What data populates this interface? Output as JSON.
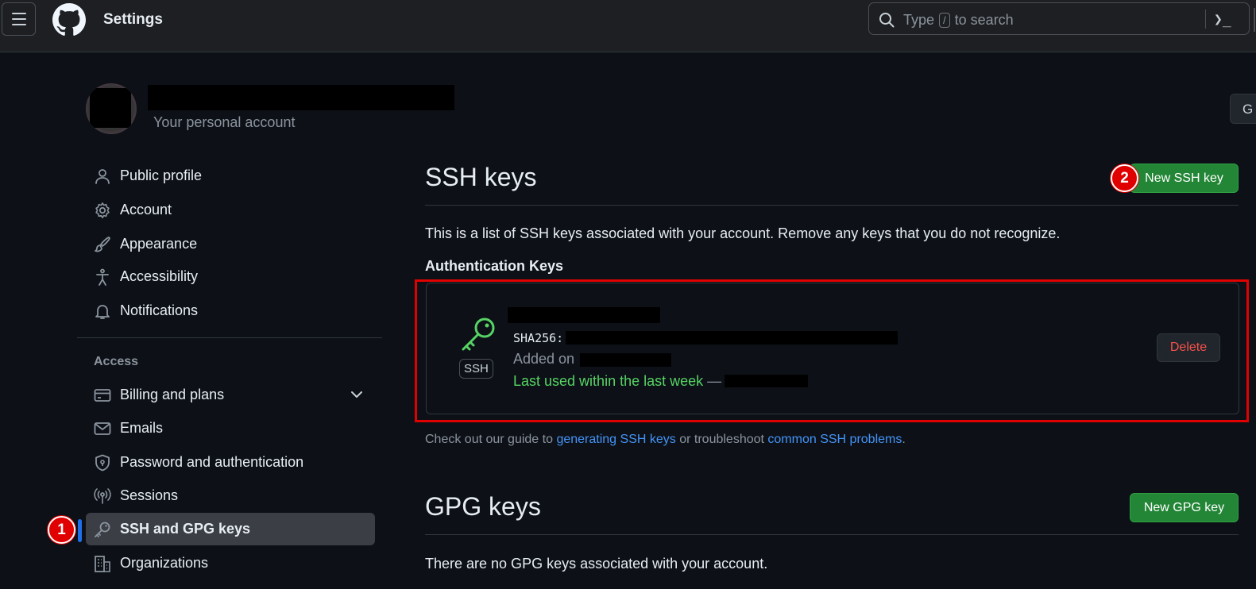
{
  "header": {
    "title": "Settings",
    "search_prefix": "Type",
    "search_kbd": "/",
    "search_suffix": "to search",
    "command_glyph": "❯_"
  },
  "profile": {
    "subtitle": "Your personal account",
    "go_button_partial": "G"
  },
  "sidebar": {
    "items": [
      {
        "label": "Public profile",
        "icon": "person-icon"
      },
      {
        "label": "Account",
        "icon": "gear-icon"
      },
      {
        "label": "Appearance",
        "icon": "paintbrush-icon"
      },
      {
        "label": "Accessibility",
        "icon": "accessibility-icon"
      },
      {
        "label": "Notifications",
        "icon": "bell-icon"
      }
    ],
    "access_heading": "Access",
    "access_items": [
      {
        "label": "Billing and plans",
        "icon": "credit-card-icon"
      },
      {
        "label": "Emails",
        "icon": "mail-icon"
      },
      {
        "label": "Password and authentication",
        "icon": "shield-lock-icon"
      },
      {
        "label": "Sessions",
        "icon": "broadcast-icon"
      },
      {
        "label": "SSH and GPG keys",
        "icon": "key-icon",
        "active": true
      },
      {
        "label": "Organizations",
        "icon": "organization-icon"
      }
    ]
  },
  "annotations": {
    "badge_1": "1",
    "badge_2": "2",
    "accent_color": "#e00000"
  },
  "ssh": {
    "heading": "SSH keys",
    "new_button": "New SSH key",
    "intro": "This is a list of SSH keys associated with your account. Remove any keys that you do not recognize.",
    "auth_heading": "Authentication Keys",
    "key": {
      "type_label": "SSH",
      "fingerprint_prefix": "SHA256:",
      "added_prefix": "Added on",
      "last_used": "Last used within the last week",
      "separator": "—",
      "delete_label": "Delete"
    },
    "guide": {
      "prefix": "Check out our guide to",
      "link1": "generating SSH keys",
      "middle": "or troubleshoot",
      "link2": "common SSH problems",
      "suffix": "."
    }
  },
  "gpg": {
    "heading": "GPG keys",
    "new_button": "New GPG key",
    "empty_text": "There are no GPG keys associated with your account."
  },
  "colors": {
    "background": "#0d1117",
    "header_bg": "#1e1f22",
    "green_button": "#238636",
    "link": "#4493f8",
    "danger": "#f85149",
    "success_text": "#56d364"
  }
}
